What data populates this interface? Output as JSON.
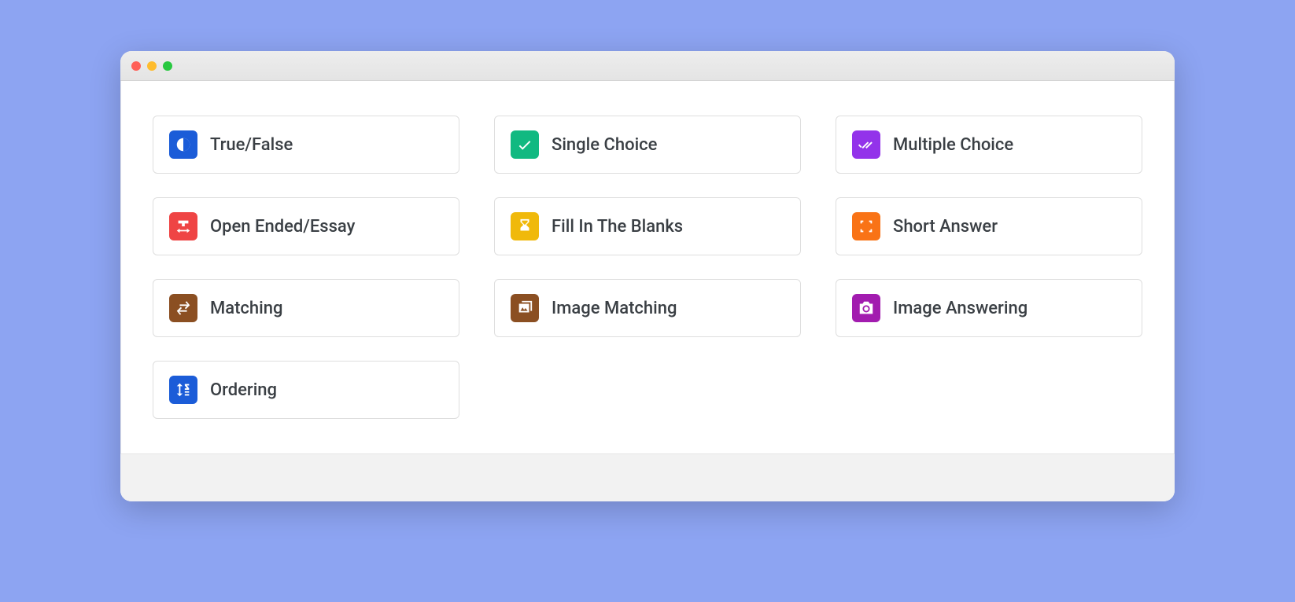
{
  "options": [
    {
      "label": "True/False",
      "icon": "half-circle-icon",
      "color": "#1b5cd8"
    },
    {
      "label": "Single Choice",
      "icon": "check-icon",
      "color": "#11b981"
    },
    {
      "label": "Multiple Choice",
      "icon": "double-check-icon",
      "color": "#9333ea"
    },
    {
      "label": "Open Ended/Essay",
      "icon": "text-width-icon",
      "color": "#ef4444"
    },
    {
      "label": "Fill In The Blanks",
      "icon": "hourglass-icon",
      "color": "#f0b90b"
    },
    {
      "label": "Short Answer",
      "icon": "compress-icon",
      "color": "#f97316"
    },
    {
      "label": "Matching",
      "icon": "swap-icon",
      "color": "#8b4f22"
    },
    {
      "label": "Image Matching",
      "icon": "images-icon",
      "color": "#8b4f22"
    },
    {
      "label": "Image Answering",
      "icon": "camera-icon",
      "color": "#a21caf"
    },
    {
      "label": "Ordering",
      "icon": "sort-az-icon",
      "color": "#1b5cd8"
    }
  ]
}
